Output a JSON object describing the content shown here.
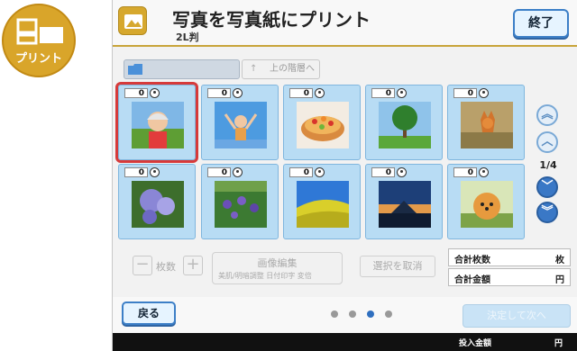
{
  "badge": {
    "label": "プリント"
  },
  "header": {
    "title": "写真を写真紙にプリント",
    "subtitle": "2L判",
    "exit_label": "終了"
  },
  "nav": {
    "up_label": "上の階層へ"
  },
  "photos": [
    {
      "count": "0",
      "subject": "child-outdoors",
      "selected": true
    },
    {
      "count": "0",
      "subject": "child-jumping-sky"
    },
    {
      "count": "0",
      "subject": "fruit-cake"
    },
    {
      "count": "0",
      "subject": "tree-field"
    },
    {
      "count": "0",
      "subject": "fox-grass"
    },
    {
      "count": "0",
      "subject": "hydrangea"
    },
    {
      "count": "0",
      "subject": "iris-flowers"
    },
    {
      "count": "0",
      "subject": "yellow-field-sky"
    },
    {
      "count": "0",
      "subject": "mountain-sunset"
    },
    {
      "count": "0",
      "subject": "pomeranian-dog"
    }
  ],
  "scroll": {
    "page": "1/4"
  },
  "quantity": {
    "label": "枚数"
  },
  "edit": {
    "title": "画像編集",
    "options": "美肌/明暗調整  日付印字  変倍"
  },
  "deselect_label": "選択を取消",
  "summary": {
    "total_sheets_label": "合計枚数",
    "total_sheets_unit": "枚",
    "total_price_label": "合計金額",
    "total_price_unit": "円"
  },
  "footer": {
    "back_label": "戻る",
    "next_label": "決定して次へ",
    "page_dots": 4,
    "active_dot": 2
  },
  "paybar": {
    "label": "投入金額",
    "unit": "円"
  },
  "colors": {
    "accent_gold": "#d6a82e",
    "tile_blue": "#b8dcf4",
    "selection_red": "#d63a3a",
    "button_blue": "#3c7fc7"
  }
}
